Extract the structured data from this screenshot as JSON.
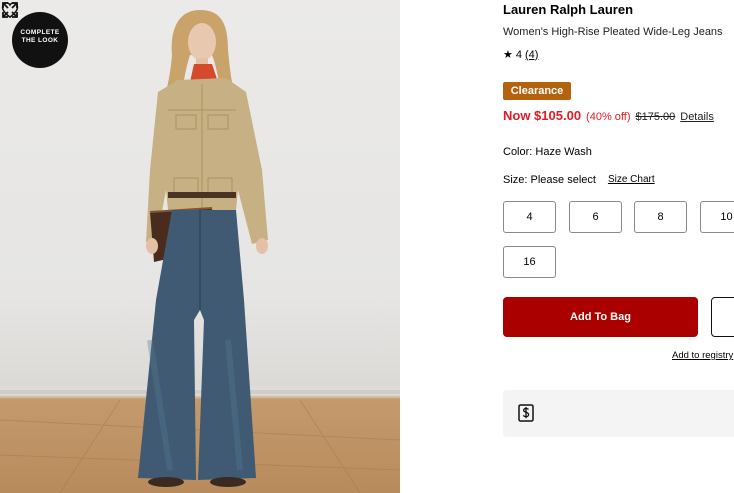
{
  "image": {
    "badge_line1": "COMPLETE",
    "badge_line2": "THE LOOK",
    "icons": [
      "heart-icon",
      "expand-icon",
      "chevron-down-icon"
    ]
  },
  "product": {
    "brand": "Lauren Ralph Lauren",
    "name": "Women's High-Rise Pleated Wide-Leg Jeans",
    "rating_value": "4",
    "rating_count": "(4)",
    "badge": "Clearance",
    "price_now": "Now $105.00",
    "price_off": "(40% off)",
    "price_original": "$175.00",
    "details_link": "Details",
    "color_label": "Color: Haze Wash",
    "size_label": "Size: Please select",
    "size_chart": "Size Chart",
    "sizes": [
      "4",
      "6",
      "8",
      "10",
      "16"
    ],
    "add_to_bag": "Add To Bag",
    "add_to_registry": "Add to registry"
  },
  "colors": {
    "badge": "#b5620c",
    "price": "#e01b24",
    "cta": "#aa0000"
  }
}
